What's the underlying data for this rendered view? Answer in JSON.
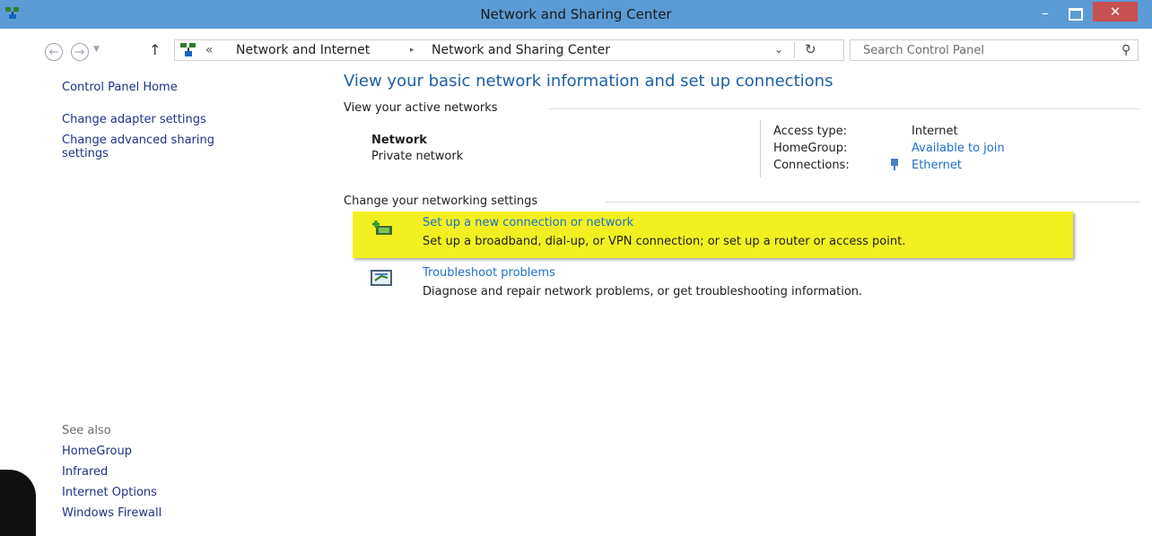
{
  "window": {
    "title": "Network and Sharing Center",
    "controls": {
      "minimize": "–",
      "close": "✕"
    }
  },
  "address_bar": {
    "back": "←",
    "forward": "→",
    "up": "↑",
    "overflow": "«",
    "breadcrumbs": [
      "Network and Internet",
      "Network and Sharing Center"
    ],
    "separator": "▸",
    "dropdown": "⌄",
    "refresh": "↻"
  },
  "search": {
    "placeholder": "Search Control Panel",
    "icon": "search-icon"
  },
  "left_pane": {
    "home": "Control Panel Home",
    "links": [
      "Change adapter settings",
      "Change advanced sharing",
      "settings"
    ],
    "see_also_label": "See also",
    "see_also": [
      "HomeGroup",
      "Infrared",
      "Internet Options",
      "Windows Firewall"
    ]
  },
  "main": {
    "heading": "View your basic network information and set up connections",
    "active_networks_label": "View your active networks",
    "network": {
      "name": "Network",
      "type": "Private network",
      "access_type_label": "Access type:",
      "access_type": "Internet",
      "homegroup_label": "HomeGroup:",
      "homegroup": "Available to join",
      "connections_label": "Connections:",
      "connection": "Ethernet"
    },
    "settings_label": "Change your networking settings",
    "tasks": [
      {
        "title": "Set up a new connection or network",
        "desc": "Set up a broadband, dial-up, or VPN connection; or set up a router or access point."
      },
      {
        "title": "Troubleshoot problems",
        "desc": "Diagnose and repair network problems, or get troubleshooting information."
      }
    ]
  },
  "colors": {
    "titlebar": "#5b9bd5",
    "close": "#c75050",
    "link": "#1e6fc9",
    "highlight": "#f3f022"
  }
}
